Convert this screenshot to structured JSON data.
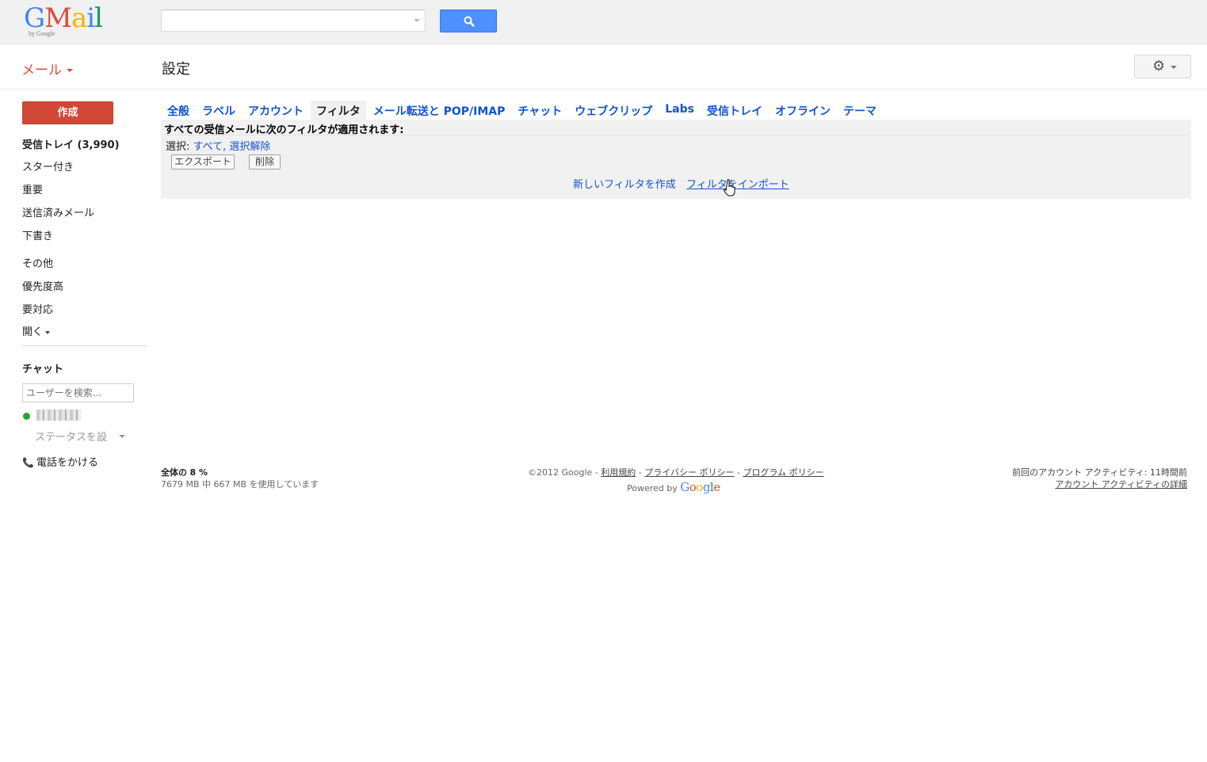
{
  "logo": {
    "word": "GMail",
    "byline": "by Google"
  },
  "search": {
    "placeholder": ""
  },
  "header": {
    "mail_menu": "メール",
    "page_title": "設定"
  },
  "sidebar": {
    "compose": "作成",
    "items": [
      {
        "label": "受信トレイ (3,990)",
        "bold": true
      },
      {
        "label": "スター付き"
      },
      {
        "label": "重要"
      },
      {
        "label": "送信済みメール"
      },
      {
        "label": "下書き"
      },
      {
        "label": "その他"
      },
      {
        "label": "優先度高"
      },
      {
        "label": "要対応"
      },
      {
        "label": "開く"
      }
    ],
    "chat_title": "チャット",
    "chat_search_placeholder": "ユーザーを検索...",
    "status_label": "ステータスを設定",
    "phone_label": "電話をかける"
  },
  "settings_tabs": [
    "全般",
    "ラベル",
    "アカウント",
    "フィルタ",
    "メール転送と POP/IMAP",
    "チャット",
    "ウェブクリップ",
    "Labs",
    "受信トレイ",
    "オフライン",
    "テーマ"
  ],
  "active_tab": "フィルタ",
  "filters": {
    "heading": "すべての受信メールに次のフィルタが適用されます:",
    "select_label": "選択:",
    "select_all": "すべて",
    "select_none": "選択解除",
    "export_button": "エクスポート",
    "delete_button": "削除",
    "create_link": "新しいフィルタを作成",
    "import_link": "フィルタをインポート"
  },
  "footer": {
    "usage_prefix": "全体の",
    "usage_percent": "8 %",
    "usage_detail": "7679 MB 中 667 MB を使用しています",
    "copyright": "©2012 Google -",
    "terms": "利用規約",
    "privacy": "プライバシー ポリシー",
    "program": "プログラム ポリシー",
    "powered_by": "Powered by",
    "powered_google": "Google",
    "last_activity": "前回のアカウント アクティビティ: 11時間前",
    "activity_details": "アカウント アクティビティの詳細"
  }
}
